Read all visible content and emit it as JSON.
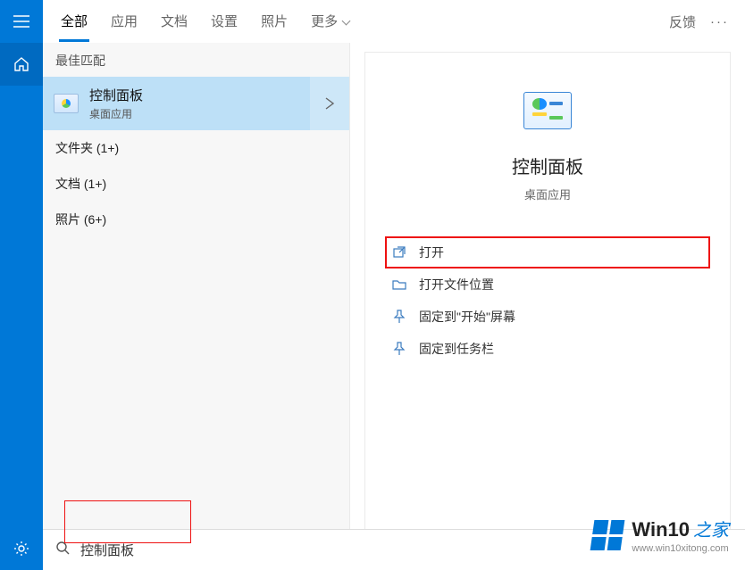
{
  "tabs": {
    "all": "全部",
    "apps": "应用",
    "docs": "文档",
    "settings": "设置",
    "photos": "照片",
    "more": "更多"
  },
  "topright": {
    "feedback": "反馈"
  },
  "left": {
    "best_match": "最佳匹配",
    "result_title": "控制面板",
    "result_sub": "桌面应用",
    "cat_folders": "文件夹 (1+)",
    "cat_docs": "文档 (1+)",
    "cat_photos": "照片 (6+)"
  },
  "detail": {
    "title": "控制面板",
    "sub": "桌面应用",
    "open": "打开",
    "open_location": "打开文件位置",
    "pin_start": "固定到\"开始\"屏幕",
    "pin_taskbar": "固定到任务栏"
  },
  "search": {
    "value": "控制面板"
  },
  "watermark": {
    "brand": "Win10",
    "suffix": "之家",
    "url": "www.win10xitong.com"
  }
}
